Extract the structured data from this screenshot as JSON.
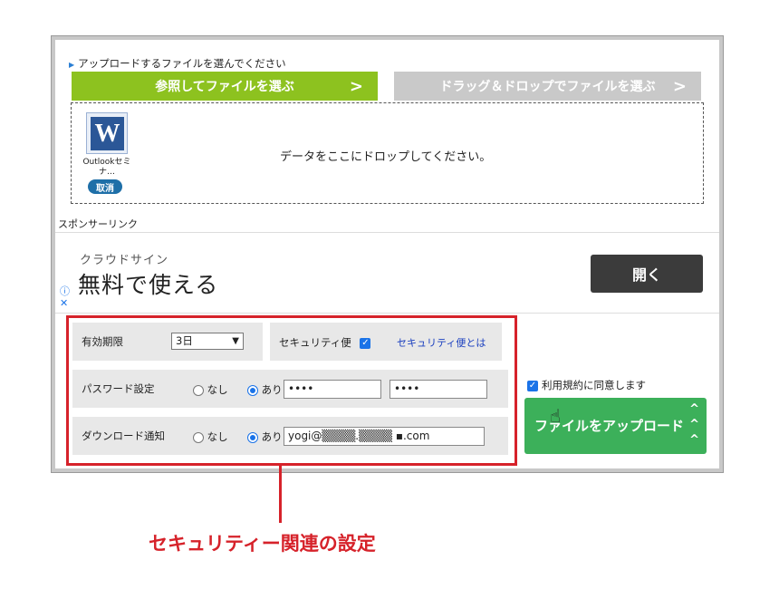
{
  "upload": {
    "label": "アップロードするファイルを選んでください",
    "browse_label": "参照してファイルを選ぶ",
    "drag_label": "ドラッグ＆ドロップでファイルを選ぶ",
    "chevron": ">",
    "drop_text": "データをここにドロップしてください。",
    "file": {
      "name": "Outlookセミナ…",
      "icon_letter": "W",
      "icon": "word-doc-icon",
      "cancel_label": "取消"
    }
  },
  "sponsor": {
    "label": "スポンサーリンク",
    "ad_sub": "クラウドサイン",
    "ad_main": "無料で使える",
    "ad_button": "開く",
    "ad_info": "ⓘ",
    "ad_close": "✕"
  },
  "settings": {
    "expiry_label": "有効期限",
    "expiry_value": "3日",
    "security_label": "セキュリティ便",
    "security_checked": true,
    "security_link": "セキュリティ便とは",
    "password_label": "パスワード設定",
    "password_none": "なし",
    "password_yes": "あり",
    "password_value_1": "••••",
    "password_value_2": "••••",
    "notify_label": "ダウンロード通知",
    "notify_none": "なし",
    "notify_yes": "あり",
    "notify_email": "yogi@▒▒▒▒.▒▒▒▒ ▪.com"
  },
  "actions": {
    "agree_label": "利用規約に同意します",
    "upload_label": "ファイルをアップロード",
    "upload_icon": "^\n^\n^"
  },
  "annotation": {
    "label": "セキュリティー関連の設定"
  },
  "colors": {
    "green": "#8dc21f",
    "upload_green": "#3cb05a",
    "annotation_red": "#d6222a",
    "gray": "#c9c9c9"
  }
}
